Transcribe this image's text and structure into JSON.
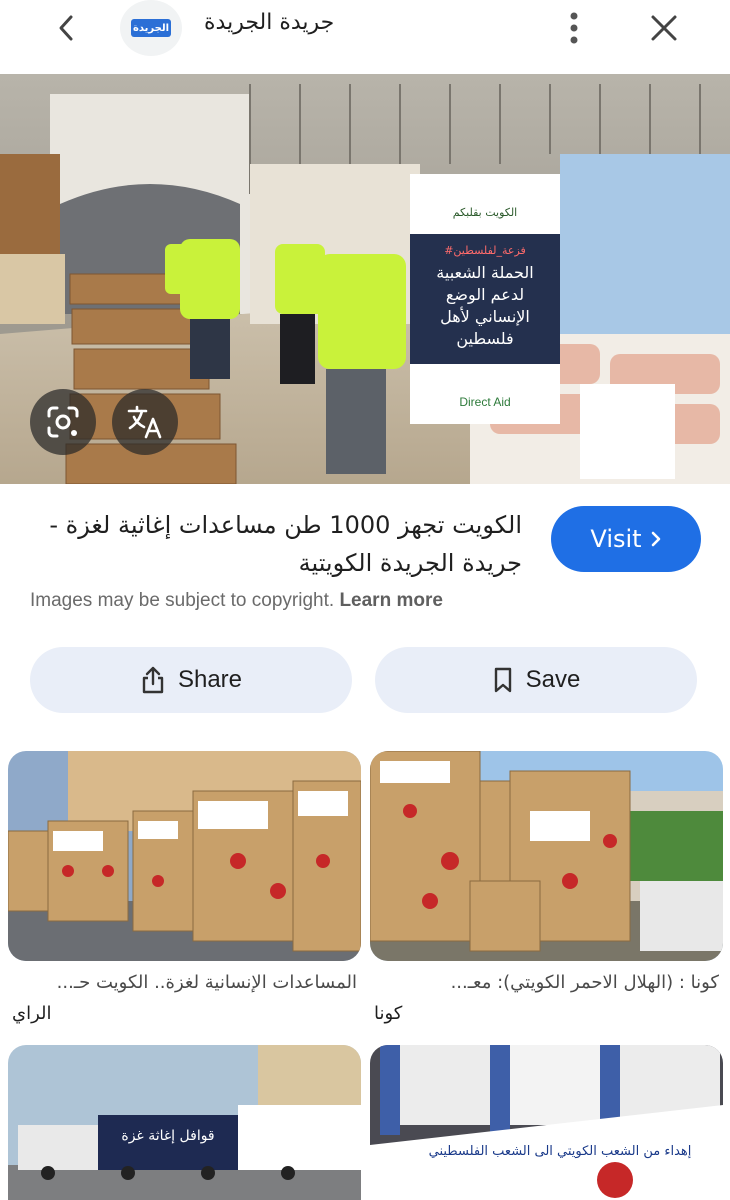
{
  "header": {
    "site_name": "جريدة الجريدة",
    "logo_text": "الجريدة",
    "icons": {
      "back": "chevron-left-icon",
      "more": "more-vert-icon",
      "close": "close-icon"
    }
  },
  "result": {
    "title_line1": "الكويت تجهز 1000 طن مساعدات إغاثية لغزة -",
    "title_line2": "جريدة الجريدة الكويتية",
    "visit_label": "Visit",
    "copyright_text": "Images may be subject to copyright.",
    "learn_more": "Learn more",
    "share_label": "Share",
    "save_label": "Save"
  },
  "banner": {
    "line0": "الكويت بقلبكم",
    "line1": "#فزعة_لفلسطين",
    "line2": "الحملة الشعبية",
    "line3": "لدعم الوضع",
    "line4": "الإنساني لأهل",
    "line5": "فلسطين",
    "sponsor": "Direct Aid"
  },
  "related": [
    {
      "caption": "المساعدات الإنسانية لغزة.. الكويت حـ...",
      "source": "الراي"
    },
    {
      "caption": "كونا : (الهلال الاحمر الكويتي): معـ...",
      "source": "كونا"
    },
    {
      "overlay": "قوافل إغاثة غزة"
    },
    {
      "overlay": "إهداء من الشعب الكويتي الى الشعب الفلسطيني"
    }
  ],
  "colors": {
    "accent": "#1f6fe5",
    "pill_bg": "#e9eef8",
    "vest": "#c9f23a"
  }
}
